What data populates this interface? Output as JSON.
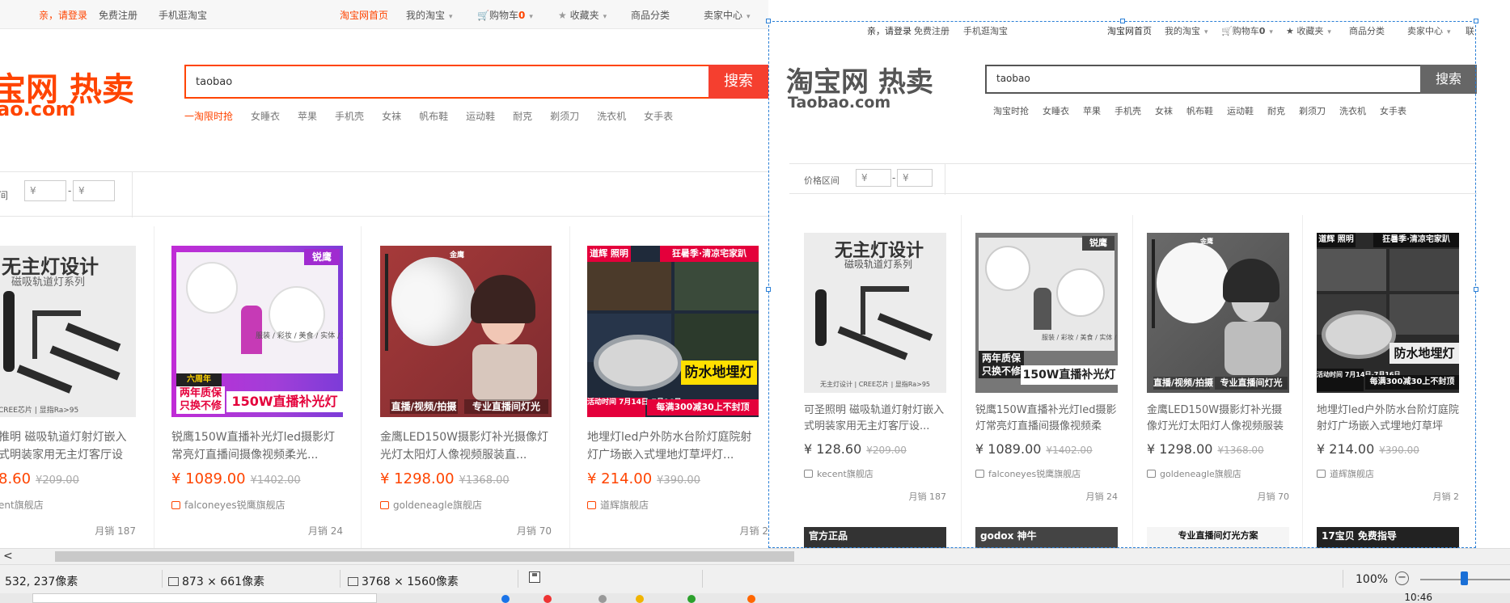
{
  "left_page": {
    "topbar": {
      "login": "亲，请登录",
      "register": "免费注册",
      "mobile": "手机逛淘宝",
      "home": "淘宝网首页",
      "my_taobao": "我的淘宝",
      "cart_label": "购物车",
      "cart_count": "0",
      "favorites": "收藏夹",
      "categories": "商品分类",
      "seller_center": "卖家中心"
    },
    "logo_line1": "宝网 热卖",
    "logo_line2": "ao.com",
    "search_query": "taobao",
    "search_button": "搜索",
    "hotwords": [
      "一淘限时抢",
      "女睡衣",
      "苹果",
      "手机壳",
      "女袜",
      "帆布鞋",
      "运动鞋",
      "耐克",
      "剃须刀",
      "洗衣机",
      "女手表"
    ],
    "price_filter": {
      "label": "间",
      "min_placeholder": "¥",
      "max_placeholder": "¥",
      "dash": "-"
    },
    "products": [
      {
        "title": "推明 磁吸轨道灯射灯嵌入式明装家用无主灯客厅设计...",
        "price": "8.60",
        "old_price": "¥209.00",
        "shop": "ent旗舰店",
        "sales": "月销 187"
      },
      {
        "title": "锐鹰150W直播补光灯led摄影灯常亮灯直播间摄像视频柔光...",
        "price": "¥ 1089.00",
        "old_price": "¥1402.00",
        "shop": "falconeyes锐鹰旗舰店",
        "sales": "月销 24"
      },
      {
        "title": "金鹰LED150W摄影灯补光摄像灯光灯太阳灯人像视频服装直...",
        "price": "¥ 1298.00",
        "old_price": "¥1368.00",
        "shop": "goldeneagle旗舰店",
        "sales": "月销 70"
      },
      {
        "title": "地埋灯led户外防水台阶灯庭院射灯广场嵌入式埋地灯草坪灯...",
        "price": "¥ 214.00",
        "old_price": "¥390.00",
        "shop": "道辉旗舰店",
        "sales": "月销 2"
      }
    ]
  },
  "right_page": {
    "topbar": {
      "login": "亲，请登录",
      "register": "免费注册",
      "mobile": "手机逛淘宝",
      "home": "淘宝网首页",
      "my_taobao": "我的淘宝",
      "cart_label": "购物车",
      "cart_count": "0",
      "favorites": "收藏夹",
      "categories": "商品分类",
      "seller_center": "卖家中心",
      "more": "联"
    },
    "logo_line1": "淘宝网 热卖",
    "logo_line2": "Taobao.com",
    "search_query": "taobao",
    "search_button": "搜索",
    "hotwords": [
      "淘宝时抢",
      "女睡衣",
      "苹果",
      "手机壳",
      "女袜",
      "帆布鞋",
      "运动鞋",
      "耐克",
      "剃须刀",
      "洗衣机",
      "女手表"
    ],
    "price_filter": {
      "label": "价格区间",
      "min_placeholder": "¥",
      "max_placeholder": "¥",
      "dash": "-"
    },
    "products": [
      {
        "title": "可圣照明 磁吸轨道灯射灯嵌入式明装家用无主灯客厅设...",
        "price": "¥ 128.60",
        "old_price": "¥209.00",
        "shop": "kecent旗舰店",
        "sales": "月销 187"
      },
      {
        "title": "锐鹰150W直播补光灯led摄影灯常亮灯直播间摄像视频柔光...",
        "price": "¥ 1089.00",
        "old_price": "¥1402.00",
        "shop": "falconeyes锐鹰旗舰店",
        "sales": "月销 24"
      },
      {
        "title": "金鹰LED150W摄影灯补光摄像灯光灯太阳灯人像视频服装直...",
        "price": "¥ 1298.00",
        "old_price": "¥1368.00",
        "shop": "goldeneagle旗舰店",
        "sales": "月销 70"
      },
      {
        "title": "地埋灯led户外防水台阶灯庭院射灯广场嵌入式埋地灯草坪灯...",
        "price": "¥ 214.00",
        "old_price": "¥390.00",
        "shop": "道辉旗舰店",
        "sales": "月销 2"
      }
    ],
    "second_row_banners": [
      "官方正品",
      "godox 神牛",
      "专业直播间灯光方案",
      "17宝贝 免费指导"
    ]
  },
  "product_art": {
    "p1_heading": "无主灯设计",
    "p1_sub": "磁吸轨道灯系列",
    "p1_footer": [
      "无主灯设计",
      "CREE芯片",
      "显指Ra>95"
    ],
    "p2_badge1": "两年质保",
    "p2_badge2": "只换不修",
    "p2_banner": "150W直播补光灯",
    "p2_brand": "锐鹰",
    "p2_tags": "服装 / 彩妆 / 美食 / 实体 / 直播",
    "p2_badge_top": "六周年",
    "p3_brand": "金鹰",
    "p3_caption1": "直播/视频/拍摄",
    "p3_caption2": "专业直播间灯光",
    "p4_tag1": "道辉 照明",
    "p4_tag2": "狂暑季·清凉宅家趴",
    "p4_product": "防水地埋灯",
    "p4_event": "活动时间 7月14日-7月16日",
    "p4_promo": "每满300减30上不封顶"
  },
  "statusbar": {
    "cursor": "532, 237像素",
    "selection_size": "873 × 661像素",
    "image_size": "3768 × 1560像素",
    "zoom": "100%"
  },
  "hscroll": {
    "left_arrow": "<"
  },
  "clock": "10:46",
  "colors": {
    "taobao_orange": "#ff4400",
    "search_btn_red": "#f53f2f",
    "selection_blue": "#2a7fd6",
    "zoom_thumb_blue": "#1a6fd6"
  }
}
